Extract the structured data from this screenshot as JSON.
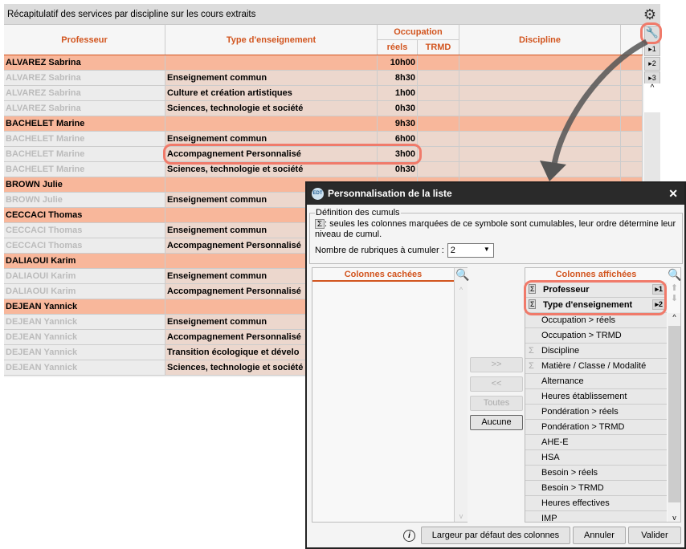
{
  "main": {
    "title": "Récapitulatif des services par discipline sur les cours extraits",
    "headers": {
      "professeur": "Professeur",
      "type": "Type d'enseignement",
      "occupation": "Occupation",
      "reels": "réels",
      "trmd": "TRMD",
      "discipline": "Discipline"
    },
    "side_buttons": [
      "▸1",
      "▸2",
      "▸3"
    ],
    "rows": [
      {
        "kind": "grp",
        "prof": "ALVAREZ Sabrina",
        "type": "",
        "reels": "10h00"
      },
      {
        "kind": "sub",
        "prof": "ALVAREZ Sabrina",
        "type": "Enseignement commun",
        "reels": "8h30"
      },
      {
        "kind": "sub",
        "prof": "ALVAREZ Sabrina",
        "type": "Culture et création artistiques",
        "reels": "1h00"
      },
      {
        "kind": "sub",
        "prof": "ALVAREZ Sabrina",
        "type": "Sciences, technologie et société",
        "reels": "0h30"
      },
      {
        "kind": "grp",
        "prof": "BACHELET Marine",
        "type": "",
        "reels": "9h30"
      },
      {
        "kind": "sub",
        "prof": "BACHELET Marine",
        "type": "Enseignement commun",
        "reels": "6h00"
      },
      {
        "kind": "sub",
        "prof": "BACHELET Marine",
        "type": "Accompagnement Personnalisé",
        "reels": "3h00"
      },
      {
        "kind": "sub",
        "prof": "BACHELET Marine",
        "type": "Sciences, technologie et société",
        "reels": "0h30"
      },
      {
        "kind": "grp",
        "prof": "BROWN Julie",
        "type": "",
        "reels": ""
      },
      {
        "kind": "sub",
        "prof": "BROWN Julie",
        "type": "Enseignement commun",
        "reels": ""
      },
      {
        "kind": "grp",
        "prof": "CECCACI Thomas",
        "type": "",
        "reels": ""
      },
      {
        "kind": "sub",
        "prof": "CECCACI Thomas",
        "type": "Enseignement commun",
        "reels": ""
      },
      {
        "kind": "sub",
        "prof": "CECCACI Thomas",
        "type": "Accompagnement Personnalisé",
        "reels": ""
      },
      {
        "kind": "grp",
        "prof": "DALIAOUI Karim",
        "type": "",
        "reels": ""
      },
      {
        "kind": "sub",
        "prof": "DALIAOUI Karim",
        "type": "Enseignement commun",
        "reels": ""
      },
      {
        "kind": "sub",
        "prof": "DALIAOUI Karim",
        "type": "Accompagnement Personnalisé",
        "reels": ""
      },
      {
        "kind": "grp",
        "prof": "DEJEAN Yannick",
        "type": "",
        "reels": ""
      },
      {
        "kind": "sub",
        "prof": "DEJEAN Yannick",
        "type": "Enseignement commun",
        "reels": ""
      },
      {
        "kind": "sub",
        "prof": "DEJEAN Yannick",
        "type": "Accompagnement Personnalisé",
        "reels": ""
      },
      {
        "kind": "sub",
        "prof": "DEJEAN Yannick",
        "type": "Transition écologique et dévelo",
        "reels": ""
      },
      {
        "kind": "sub",
        "prof": "DEJEAN Yannick",
        "type": "Sciences, technologie et société",
        "reels": ""
      }
    ]
  },
  "dialog": {
    "title": "Personnalisation de la liste",
    "icon_text": "EDT",
    "close": "✕",
    "legend": "Définition des cumuls",
    "sigma": "Σ",
    "description": ": seules les colonnes marquées de ce symbole sont cumulables, leur ordre détermine leur niveau de cumul.",
    "count_label": "Nombre de rubriques à cumuler :",
    "count_value": "2",
    "hidden_header": "Colonnes cachées",
    "shown_header": "Colonnes affichées",
    "move_right": ">>",
    "move_left": "<<",
    "all": "Toutes",
    "none": "Aucune",
    "shown": [
      {
        "label": "Professeur",
        "sigma": true,
        "bold": true,
        "level": "▸1"
      },
      {
        "label": "Type d'enseignement",
        "sigma": true,
        "bold": true,
        "level": "▸2"
      },
      {
        "label": "Occupation > réels"
      },
      {
        "label": "Occupation > TRMD"
      },
      {
        "label": "Discipline",
        "sigma": true
      },
      {
        "label": "Matière / Classe / Modalité",
        "sigma": true
      },
      {
        "label": "Alternance"
      },
      {
        "label": "Heures établissement"
      },
      {
        "label": "Pondération > réels"
      },
      {
        "label": "Pondération > TRMD"
      },
      {
        "label": "AHE-E"
      },
      {
        "label": "HSA"
      },
      {
        "label": "Besoin > réels"
      },
      {
        "label": "Besoin > TRMD"
      },
      {
        "label": "Heures effectives"
      },
      {
        "label": "IMP"
      }
    ],
    "default_width": "Largeur par défaut des colonnes",
    "cancel": "Annuler",
    "validate": "Valider"
  },
  "colors": {
    "accent": "#d2551f",
    "group_row": "#f8b79b",
    "sub_row": "#ecd7cd",
    "highlight": "#f07a6a"
  }
}
